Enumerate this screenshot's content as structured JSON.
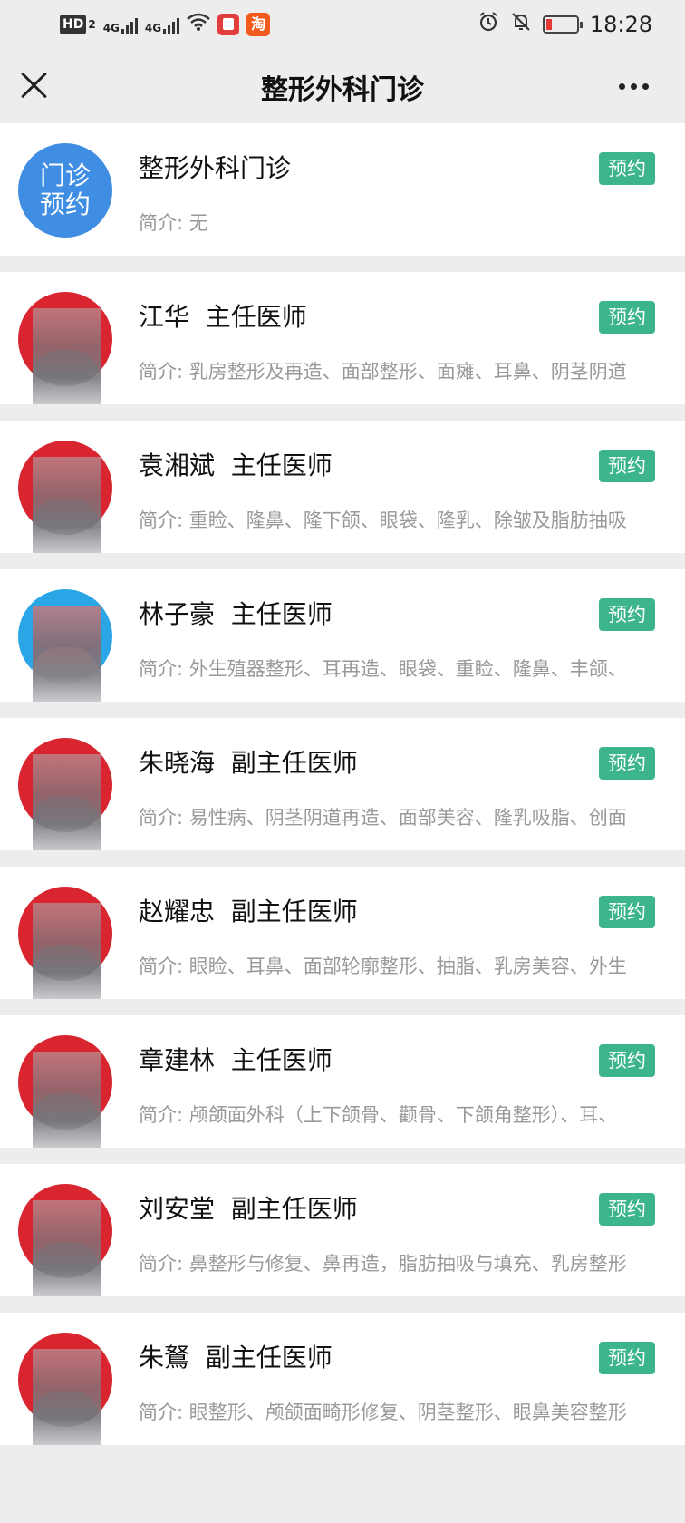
{
  "status_bar": {
    "network_hd": "HD",
    "network_hd_sub": "2",
    "sim1": "4G",
    "sim2": "4G",
    "app_icon_2_text": "淘",
    "time": "18:28",
    "battery_color": "#e53935"
  },
  "nav": {
    "title": "整形外科门诊"
  },
  "department": {
    "avatar_text_line1": "门诊",
    "avatar_text_line2": "预约",
    "name": "整形外科门诊",
    "intro": "简介: 无",
    "book_label": "预约"
  },
  "doctors": [
    {
      "name": "江华  主任医师",
      "intro": "简介: 乳房整形及再造、面部整形、面瘫、耳鼻、阴茎阴道",
      "book_label": "预约"
    },
    {
      "name": "袁湘斌  主任医师",
      "intro": "简介: 重睑、隆鼻、隆下颌、眼袋、隆乳、除皱及脂肪抽吸",
      "book_label": "预约"
    },
    {
      "name": "林子豪  主任医师",
      "intro": "简介: 外生殖器整形、耳再造、眼袋、重睑、隆鼻、丰颌、",
      "book_label": "预约"
    },
    {
      "name": "朱晓海  副主任医师",
      "intro": "简介: 易性病、阴茎阴道再造、面部美容、隆乳吸脂、创面",
      "book_label": "预约"
    },
    {
      "name": "赵耀忠  副主任医师",
      "intro": "简介: 眼睑、耳鼻、面部轮廓整形、抽脂、乳房美容、外生",
      "book_label": "预约"
    },
    {
      "name": "章建林  主任医师",
      "intro": "简介: 颅颌面外科（上下颌骨、颧骨、下颌角整形）、耳、",
      "book_label": "预约"
    },
    {
      "name": "刘安堂  副主任医师",
      "intro": "简介: 鼻整形与修复、鼻再造，脂肪抽吸与填充、乳房整形",
      "book_label": "预约"
    },
    {
      "name": "朱鴑  副主任医师",
      "intro": "简介: 眼整形、颅颌面畸形修复、阴茎整形、眼鼻美容整形",
      "book_label": "预约"
    }
  ],
  "colors": {
    "book_button": "#3cb58e",
    "dept_avatar": "#3f8ee3",
    "page_bg": "#ededed"
  }
}
